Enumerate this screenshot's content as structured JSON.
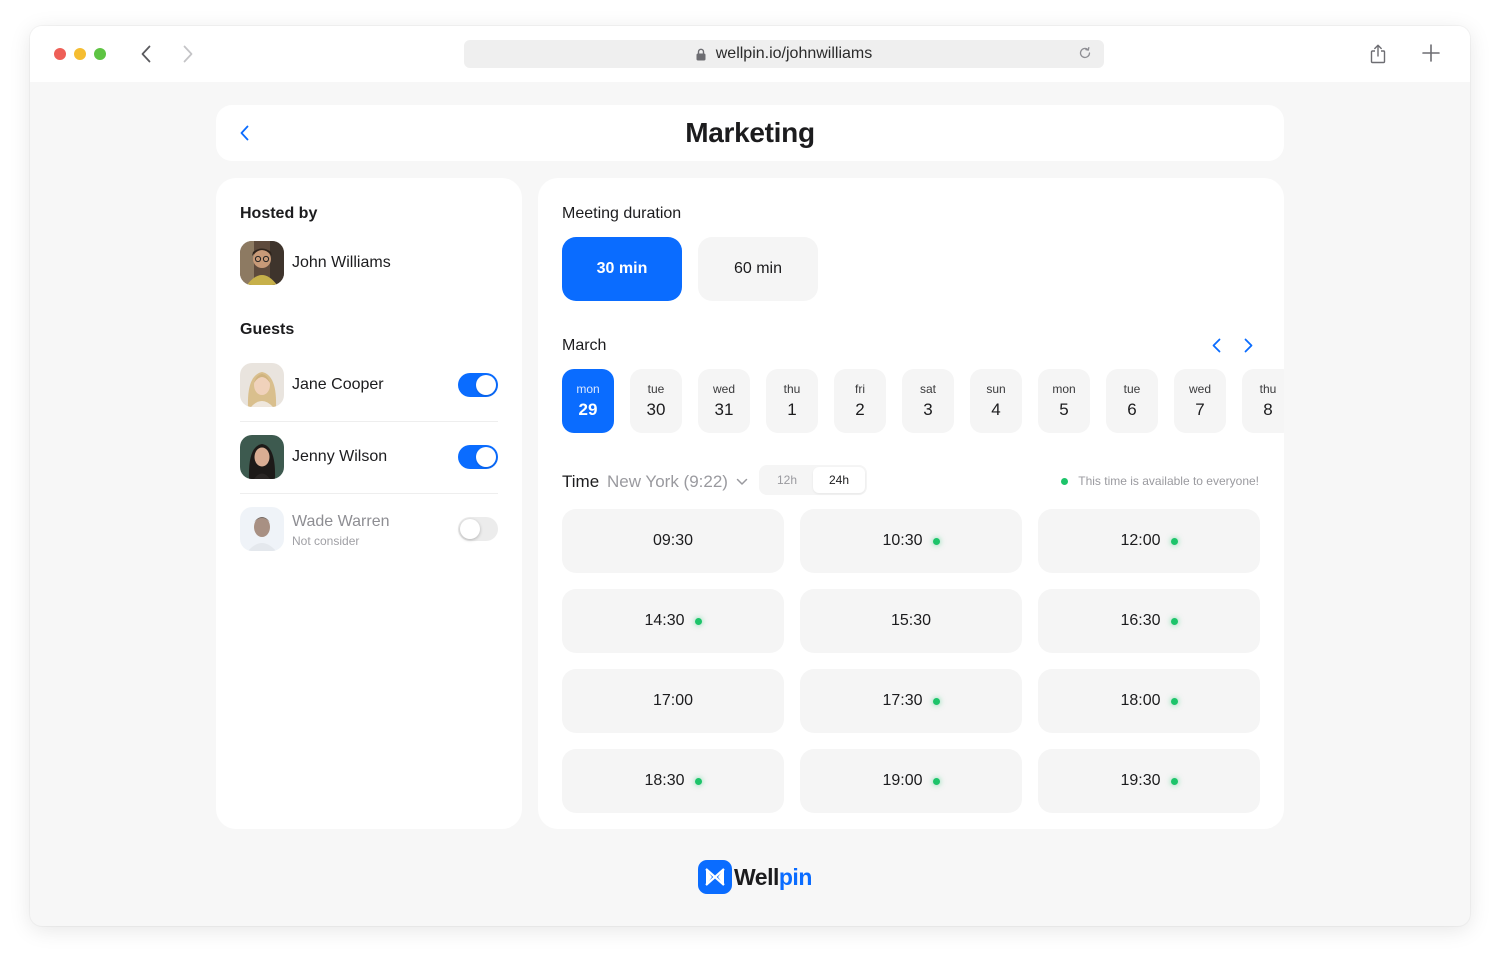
{
  "browser": {
    "url": "wellpin.io/johnwilliams"
  },
  "page": {
    "title": "Marketing"
  },
  "host": {
    "section_title": "Hosted by",
    "name": "John Williams"
  },
  "guests": {
    "section_title": "Guests",
    "items": [
      {
        "name": "Jane Cooper",
        "enabled": true
      },
      {
        "name": "Jenny Wilson",
        "enabled": true
      },
      {
        "name": "Wade Warren",
        "subtitle": "Not consider",
        "enabled": false
      }
    ]
  },
  "duration": {
    "label": "Meeting duration",
    "options": [
      {
        "label": "30 min",
        "selected": true
      },
      {
        "label": "60 min",
        "selected": false
      }
    ]
  },
  "calendar": {
    "month": "March",
    "days": [
      {
        "weekday": "mon",
        "day": "29",
        "selected": true
      },
      {
        "weekday": "tue",
        "day": "30"
      },
      {
        "weekday": "wed",
        "day": "31"
      },
      {
        "weekday": "thu",
        "day": "1"
      },
      {
        "weekday": "fri",
        "day": "2"
      },
      {
        "weekday": "sat",
        "day": "3"
      },
      {
        "weekday": "sun",
        "day": "4"
      },
      {
        "weekday": "mon",
        "day": "5"
      },
      {
        "weekday": "tue",
        "day": "6"
      },
      {
        "weekday": "wed",
        "day": "7"
      },
      {
        "weekday": "thu",
        "day": "8"
      }
    ]
  },
  "time": {
    "label": "Time",
    "timezone": "New York (9:22)",
    "format_options": [
      "12h",
      "24h"
    ],
    "selected_format": "24h",
    "availability_legend": "This time is available to everyone!",
    "slots": [
      {
        "time": "09:30",
        "available_to_all": false
      },
      {
        "time": "10:30",
        "available_to_all": true
      },
      {
        "time": "12:00",
        "available_to_all": true
      },
      {
        "time": "14:30",
        "available_to_all": true
      },
      {
        "time": "15:30",
        "available_to_all": false
      },
      {
        "time": "16:30",
        "available_to_all": true
      },
      {
        "time": "17:00",
        "available_to_all": false
      },
      {
        "time": "17:30",
        "available_to_all": true
      },
      {
        "time": "18:00",
        "available_to_all": true
      },
      {
        "time": "18:30",
        "available_to_all": true
      },
      {
        "time": "19:00",
        "available_to_all": true
      },
      {
        "time": "19:30",
        "available_to_all": true
      }
    ]
  },
  "brand": {
    "name_part1": "Well",
    "name_part2": "pin"
  },
  "colors": {
    "accent": "#0a6cff",
    "available": "#1dc46a",
    "card": "#ffffff",
    "background": "#f7f7f7",
    "chip": "#f5f5f5"
  }
}
